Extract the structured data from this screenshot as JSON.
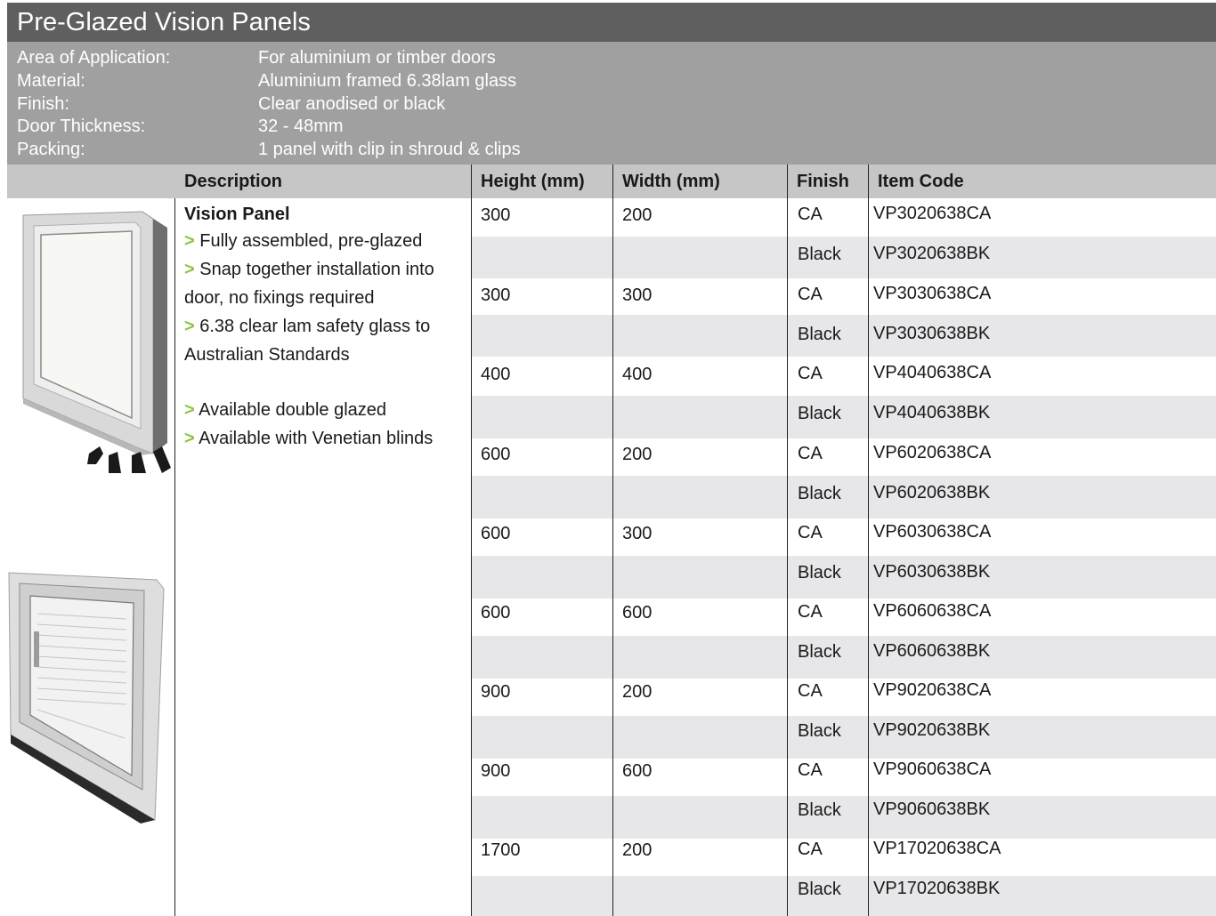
{
  "title": "Pre-Glazed Vision Panels",
  "specs": [
    {
      "label": "Area of Application:",
      "value": "For aluminium or timber doors"
    },
    {
      "label": "Material:",
      "value": "Aluminium framed 6.38lam glass"
    },
    {
      "label": "Finish:",
      "value": "Clear anodised or black"
    },
    {
      "label": "Door Thickness:",
      "value": "32 - 48mm"
    },
    {
      "label": "Packing:",
      "value": "1 panel with clip in shroud & clips"
    }
  ],
  "table": {
    "headers": {
      "description": "Description",
      "height": "Height (mm)",
      "width": "Width (mm)",
      "finish": "Finish",
      "item_code": "Item Code"
    },
    "description": {
      "title": "Vision Panel",
      "arrow": ">",
      "bullets": [
        "Fully assembled, pre-glazed",
        "Snap together installation into",
        "door, no fixings required",
        "6.38 clear lam safety glass to",
        "Australian Standards",
        "Available double glazed",
        "Available with Venetian blinds"
      ]
    },
    "groups": [
      {
        "height": "300",
        "width": "200",
        "rows": [
          {
            "finish": "CA",
            "code": "VP3020638CA"
          },
          {
            "finish": "Black",
            "code": "VP3020638BK"
          }
        ]
      },
      {
        "height": "300",
        "width": "300",
        "rows": [
          {
            "finish": "CA",
            "code": "VP3030638CA"
          },
          {
            "finish": "Black",
            "code": "VP3030638BK"
          }
        ]
      },
      {
        "height": "400",
        "width": "400",
        "rows": [
          {
            "finish": "CA",
            "code": "VP4040638CA"
          },
          {
            "finish": "Black",
            "code": "VP4040638BK"
          }
        ]
      },
      {
        "height": "600",
        "width": "200",
        "rows": [
          {
            "finish": "CA",
            "code": "VP6020638CA"
          },
          {
            "finish": "Black",
            "code": "VP6020638BK"
          }
        ]
      },
      {
        "height": "600",
        "width": "300",
        "rows": [
          {
            "finish": "CA",
            "code": "VP6030638CA"
          },
          {
            "finish": "Black",
            "code": "VP6030638BK"
          }
        ]
      },
      {
        "height": "600",
        "width": "600",
        "rows": [
          {
            "finish": "CA",
            "code": "VP6060638CA"
          },
          {
            "finish": "Black",
            "code": "VP6060638BK"
          }
        ]
      },
      {
        "height": "900",
        "width": "200",
        "rows": [
          {
            "finish": "CA",
            "code": "VP9020638CA"
          },
          {
            "finish": "Black",
            "code": "VP9020638BK"
          }
        ]
      },
      {
        "height": "900",
        "width": "600",
        "rows": [
          {
            "finish": "CA",
            "code": "VP9060638CA"
          },
          {
            "finish": "Black",
            "code": "VP9060638BK"
          }
        ]
      },
      {
        "height": "1700",
        "width": "200",
        "rows": [
          {
            "finish": "CA",
            "code": "VP17020638CA"
          },
          {
            "finish": "Black",
            "code": "VP17020638BK"
          }
        ]
      }
    ]
  },
  "colors": {
    "title_bg": "#5f5f5f",
    "spec_bg": "#a0a0a0",
    "header_bg": "#c6c6c6",
    "band_bg": "#e7e7e9",
    "arrow_accent": "#8cc63f"
  },
  "images": [
    "vision-panel-image",
    "venetian-blind-panel-image"
  ]
}
